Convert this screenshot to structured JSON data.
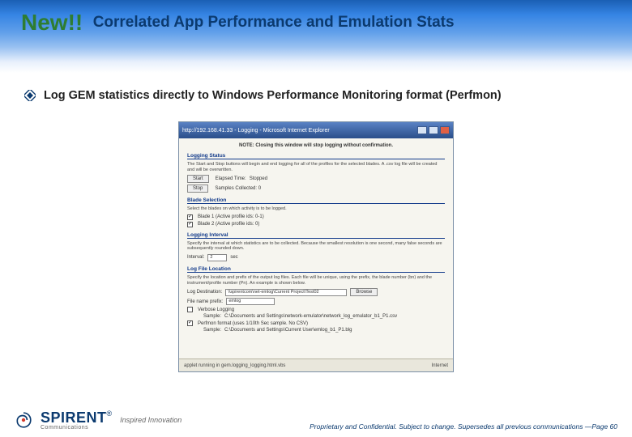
{
  "title": {
    "badge": "New!!",
    "rest": "Correlated App Performance and Emulation Stats"
  },
  "bullet": "Log GEM statistics directly to Windows Performance Monitoring format (Perfmon)",
  "dialog": {
    "window_title": "http://192.168.41.33 - Logging - Microsoft Internet Explorer",
    "note": "NOTE: Closing this window will stop logging without confirmation.",
    "sections": {
      "logging_status": {
        "header": "Logging Status",
        "desc": "The Start and Stop buttons will begin and end logging for all of the profiles for the selected blades. A .csv log file will be created and will be overwritten.",
        "start_btn": "Start",
        "stop_btn": "Stop",
        "elapsed_label": "Elapsed Time:",
        "elapsed_value": "Stopped",
        "samples_label": "Samples Collected: 0"
      },
      "blade_selection": {
        "header": "Blade Selection",
        "desc": "Select the blades on which activity is to be logged.",
        "blade1": "Blade 1   (Active profile ids: 0-1)",
        "blade2": "Blade 2   (Active profile ids: 0)"
      },
      "logging_interval": {
        "header": "Logging Interval",
        "desc": "Specify the interval at which statistics are to be collected. Because the smallest resolution is one second, many false seconds are subsequently rounded down.",
        "label": "Interval:",
        "value": "2",
        "unit": "sec"
      },
      "logfile_location": {
        "header": "Log File Location",
        "desc": "Specify the location and prefix of the output log files. Each file will be unique, using the prefix, the blade number (bn) and the instrument/profile number (Pn). An example is shown below.",
        "dest_label": "Log Destination:",
        "dest_value": "\\\\spirentcom\\net-emlog\\Current Project\\Test02",
        "browse_btn": "Browse",
        "prefix_label": "File name prefix:",
        "prefix_value": "emlog",
        "verbose_label": "Verbose Logging",
        "verbose_sample": "C:\\Documents and Settings\\network-emulator\\network_log_emulator_b1_P1.csv",
        "perfmon_label": "Perfmon format (uses 1/10th Sec sample. No CSV)",
        "perfmon_sample": "C:\\Documents and Settings\\Current User\\emlog_b1_P1.blg",
        "sample_label": "Sample:"
      }
    },
    "statusbar_left": "applet running in gem.logging_logging.html.vbs",
    "statusbar_right": "Internet"
  },
  "footer": {
    "brand": "SPIRENT",
    "brand_sub": "Communications",
    "reg": "®",
    "tagline": "Inspired Innovation",
    "legal": "Proprietary and Confidential.  Subject to change.  Supersedes all previous communications —Page 60"
  }
}
